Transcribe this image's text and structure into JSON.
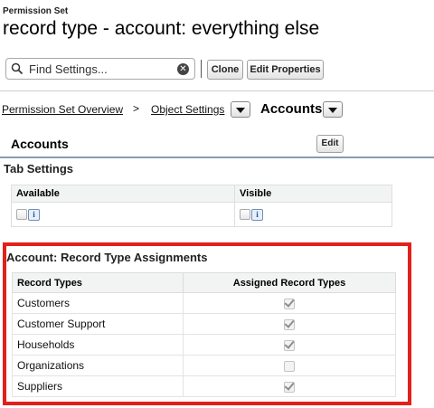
{
  "header": {
    "eyebrow": "Permission Set",
    "title": "record type - account: everything else"
  },
  "toolbar": {
    "search_placeholder": "Find Settings...",
    "clone_label": "Clone",
    "edit_properties_label": "Edit Properties"
  },
  "breadcrumb": {
    "overview": "Permission Set Overview",
    "separator": ">",
    "object_settings": "Object Settings",
    "current": "Accounts"
  },
  "accounts_section": {
    "title": "Accounts",
    "edit_label": "Edit"
  },
  "tab_settings": {
    "title": "Tab Settings",
    "col_available": "Available",
    "col_visible": "Visible",
    "info_glyph": "i"
  },
  "record_types": {
    "title": "Account: Record Type Assignments",
    "col_types": "Record Types",
    "col_assigned": "Assigned Record Types",
    "rows": [
      {
        "name": "Customers",
        "assigned": true
      },
      {
        "name": "Customer Support",
        "assigned": true
      },
      {
        "name": "Households",
        "assigned": true
      },
      {
        "name": "Organizations",
        "assigned": false
      },
      {
        "name": "Suppliers",
        "assigned": true
      }
    ]
  },
  "colors": {
    "highlight_border": "#e3201b"
  }
}
